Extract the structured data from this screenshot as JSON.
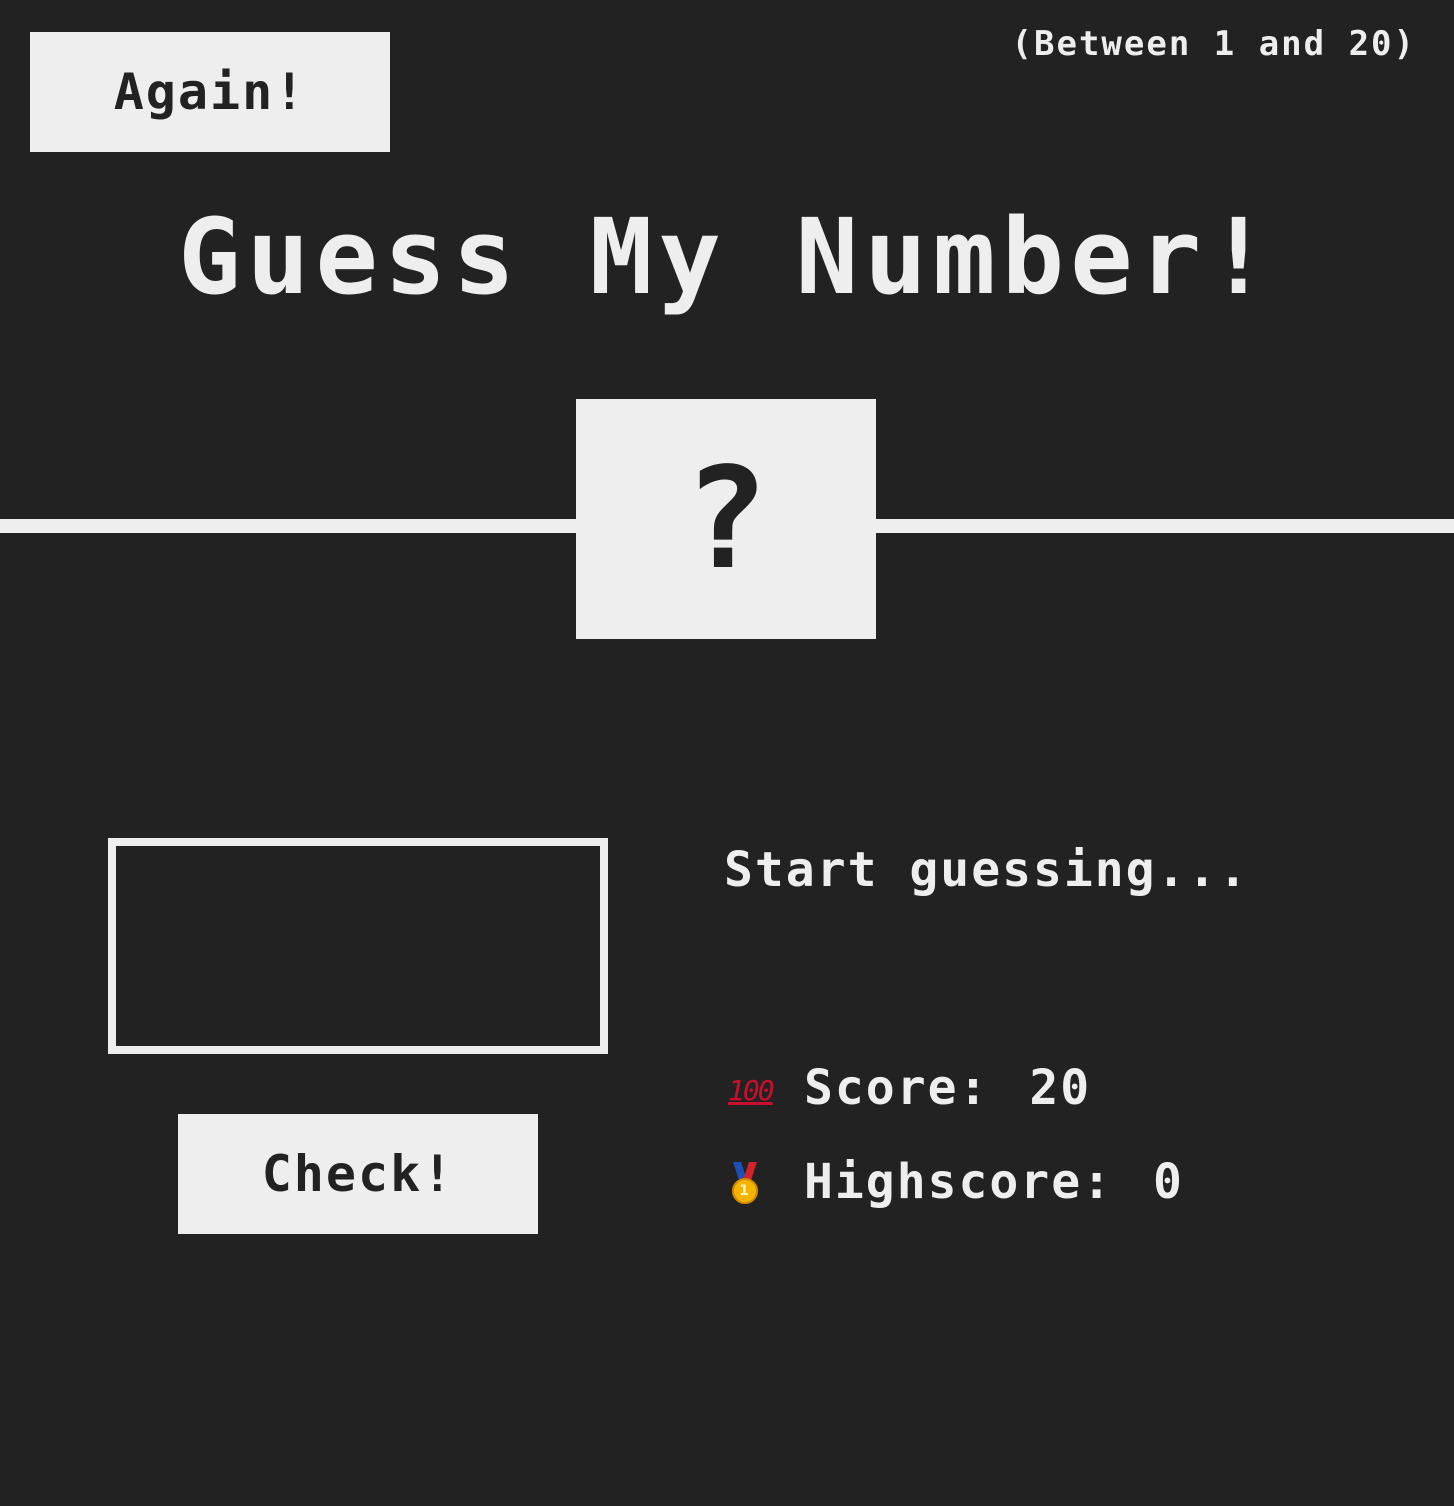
{
  "header": {
    "again_label": "Again!",
    "range_text": "(Between 1 and 20)",
    "title": "Guess My Number!"
  },
  "secret_number": {
    "display": "?"
  },
  "guess": {
    "value": "",
    "check_label": "Check!"
  },
  "status": {
    "message": "Start guessing...",
    "score_icon": "hundred-points-icon",
    "score_icon_text": "100",
    "score_label": "Score:",
    "score_value": "20",
    "highscore_icon": "first-place-medal-icon",
    "highscore_icon_text": "1",
    "highscore_label": "Highscore:",
    "highscore_value": "0"
  },
  "colors": {
    "background": "#222222",
    "foreground": "#eeeeee",
    "score_icon": "#c8102e",
    "medal_gold": "#f5b400"
  }
}
